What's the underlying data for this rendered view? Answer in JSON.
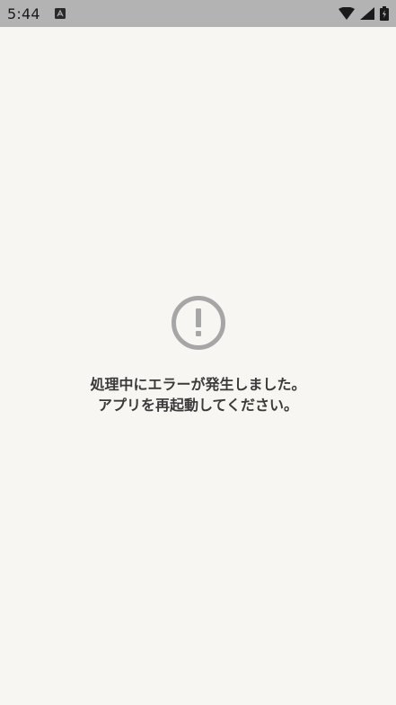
{
  "status_bar": {
    "time": "5:44",
    "icons": [
      "notification-app-icon",
      "wifi-icon",
      "signal-icon",
      "battery-icon"
    ]
  },
  "error": {
    "icon": "exclamation-circle-icon",
    "line1": "処理中にエラーが発生しました。",
    "line2": "アプリを再起動してください。"
  },
  "colors": {
    "background": "#f8f6f2",
    "status_bar": "#b3b3b3",
    "icon": "#a6a6a6",
    "text": "#3a3a3a"
  }
}
